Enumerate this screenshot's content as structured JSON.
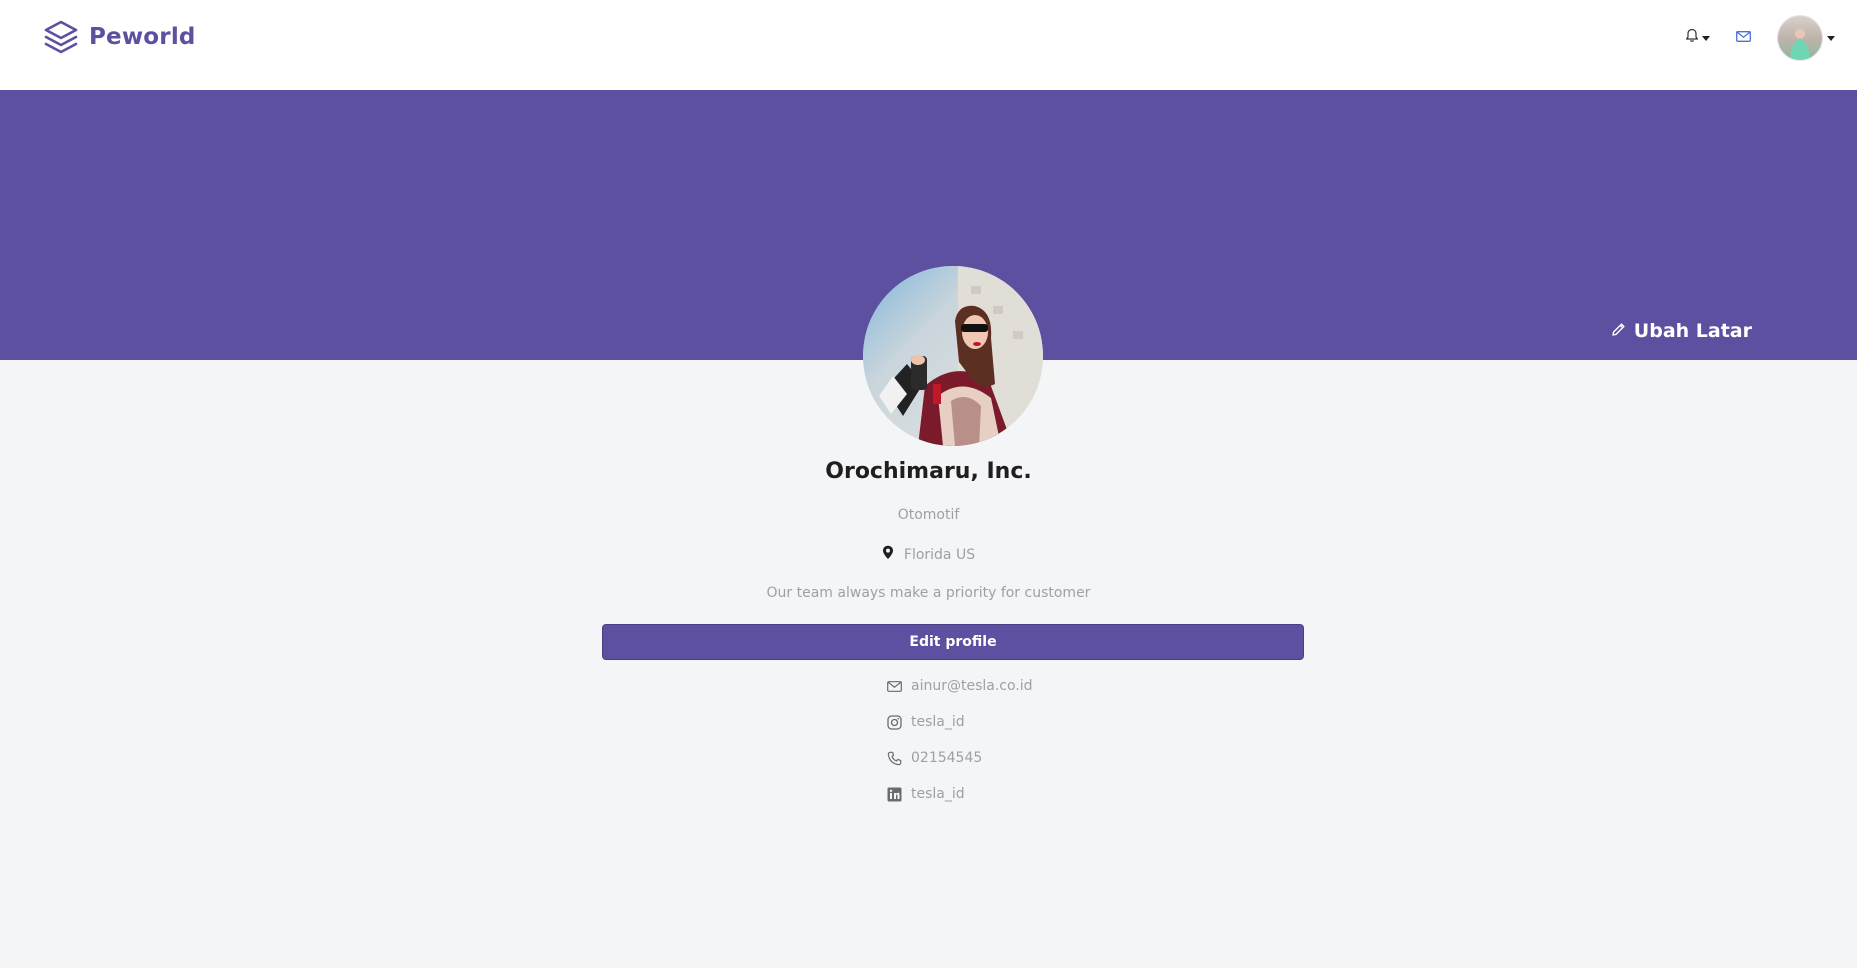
{
  "brand": {
    "name": "Peworld",
    "color": "#5e50a1"
  },
  "navbar": {
    "icons": [
      "bell-icon",
      "mail-icon",
      "avatar"
    ]
  },
  "banner": {
    "color": "#5e50a1",
    "change_background_label": "Ubah Latar"
  },
  "profile": {
    "company_name": "Orochimaru, Inc.",
    "sector": "Otomotif",
    "location": "Florida US",
    "bio": "Our team always make a priority for customer",
    "edit_button_label": "Edit profile"
  },
  "contacts": [
    {
      "icon": "mail-icon",
      "value": "ainur@tesla.co.id"
    },
    {
      "icon": "instagram-icon",
      "value": "tesla_id"
    },
    {
      "icon": "phone-icon",
      "value": "02154545"
    },
    {
      "icon": "linkedin-icon",
      "value": "tesla_id"
    }
  ]
}
